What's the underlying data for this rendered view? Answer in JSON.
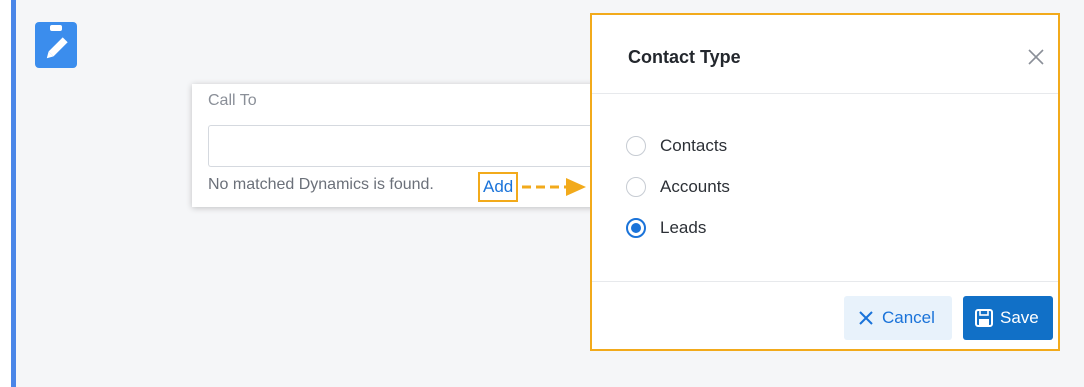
{
  "callto": {
    "label": "Call To",
    "input_value": "",
    "placeholder": "",
    "no_match_text": "No matched Dynamics is found.",
    "add_link": "Add"
  },
  "modal": {
    "title": "Contact Type",
    "options": [
      {
        "label": "Contacts",
        "selected": false
      },
      {
        "label": "Accounts",
        "selected": false
      },
      {
        "label": "Leads",
        "selected": true
      }
    ],
    "cancel_label": "Cancel",
    "save_label": "Save"
  },
  "icons": {
    "edit": "edit-clipboard-icon",
    "close": "close-icon",
    "cancel": "x-icon",
    "save": "save-disk-icon",
    "arrow": "dashed-arrow-icon"
  },
  "colors": {
    "accent": "#1a73d9",
    "highlight": "#f2aa1b",
    "save_bg": "#1170c7",
    "cancel_bg": "#e8f2fb",
    "left_bar": "#4a86e8"
  }
}
